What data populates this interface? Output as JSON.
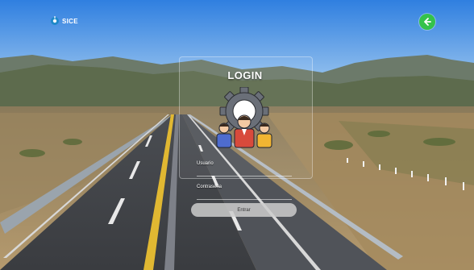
{
  "header": {
    "logo_text": "SICE",
    "back_icon": "arrow-left-icon"
  },
  "login": {
    "title": "LOGIN",
    "emblem_icon": "gear-users-icon",
    "user_label": "Usuario",
    "user_value": "",
    "password_label": "Contraseña",
    "password_value": "",
    "submit_label": "Entrar"
  },
  "colors": {
    "back_button": "#34c24a",
    "sky": "#3f8be0",
    "gear": "#6a6f78"
  }
}
